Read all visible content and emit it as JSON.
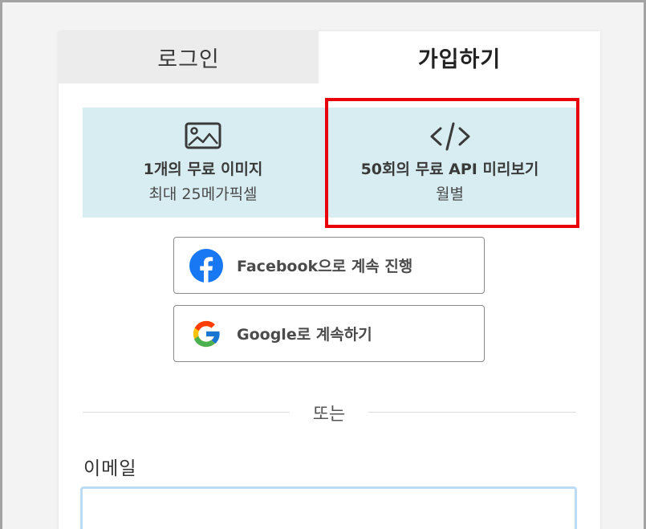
{
  "tabs": {
    "login": "로그인",
    "signup": "가입하기"
  },
  "features": [
    {
      "icon": "image-icon",
      "title": "1개의 무료 이미지",
      "subtitle": "최대 25메가픽셀"
    },
    {
      "icon": "code-icon",
      "title": "50회의 무료 API 미리보기",
      "subtitle": "월별"
    }
  ],
  "social": {
    "facebook_label": "Facebook으로 계속 진행",
    "google_label": "Google로 계속하기"
  },
  "divider_text": "또는",
  "email": {
    "label": "이메일",
    "value": "",
    "placeholder": ""
  },
  "colors": {
    "highlight": "#e8000b",
    "feature_bg": "#d8edf1",
    "facebook_blue": "#1877f2",
    "input_focus_border": "#bcdcf5"
  }
}
